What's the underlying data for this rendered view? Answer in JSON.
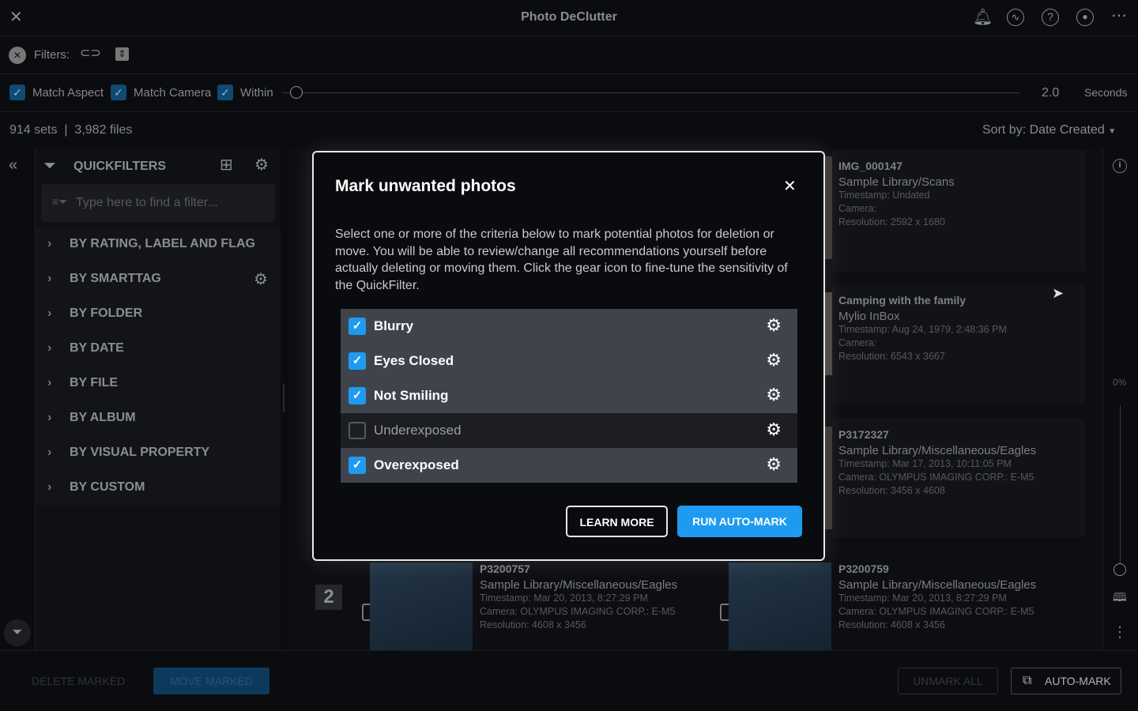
{
  "app": {
    "title": "Photo DeClutter"
  },
  "filters": {
    "label": "Filters:",
    "match_aspect": "Match Aspect",
    "match_camera": "Match Camera",
    "within": "Within",
    "within_value": "2.0",
    "within_unit": "Seconds",
    "slider_fraction": 0.02
  },
  "stats": {
    "sets": "914 sets",
    "separator": "|",
    "files": "3,982 files",
    "sort_label": "Sort by:",
    "sort_value": "Date Created"
  },
  "quickfilters": {
    "title": "QUICKFILTERS",
    "search_placeholder": "Type here to find a filter...",
    "items": [
      "BY RATING, LABEL AND FLAG",
      "BY SMARTTAG",
      "BY FOLDER",
      "BY DATE",
      "BY FILE",
      "BY ALBUM",
      "BY VISUAL PROPERTY",
      "BY CUSTOM"
    ]
  },
  "cards": [
    {
      "name": "IMG_000147",
      "path": "Sample Library/Scans",
      "timestamp": "Timestamp: Undated",
      "camera": "Camera:",
      "resolution": "Resolution: 2592 x 1680"
    },
    {
      "name": "Camping with the family",
      "path": "Mylio InBox",
      "timestamp": "Timestamp: Aug 24, 1979, 2:48:36 PM",
      "camera": "Camera:",
      "resolution": "Resolution: 6543 x 3667"
    },
    {
      "name": "P3172327",
      "path": "Sample Library/Miscellaneous/Eagles",
      "timestamp": "Timestamp: Mar 17, 2013, 10:11:05 PM",
      "camera": "Camera: OLYMPUS IMAGING CORP.: E-M5",
      "resolution": "Resolution: 3456 x 4608"
    },
    {
      "name": "P3200757",
      "path": "Sample Library/Miscellaneous/Eagles",
      "timestamp": "Timestamp: Mar 20, 2013, 8:27:29 PM",
      "camera": "Camera: OLYMPUS IMAGING CORP.: E-M5",
      "resolution": "Resolution: 4608 x 3456"
    },
    {
      "name": "P3200759",
      "path": "Sample Library/Miscellaneous/Eagles",
      "timestamp": "Timestamp: Mar 20, 2013, 8:27:29 PM",
      "camera": "Camera: OLYMPUS IMAGING CORP.: E-M5",
      "resolution": "Resolution: 4608 x 3456"
    }
  ],
  "set_number": "2",
  "rail": {
    "zoom_percent": "0%"
  },
  "bottom": {
    "delete_marked": "DELETE MARKED",
    "move_marked": "MOVE MARKED",
    "unmark_all": "UNMARK ALL",
    "auto_mark": "AUTO-MARK"
  },
  "modal": {
    "title": "Mark unwanted photos",
    "description": "Select one or more of the criteria below to mark potential photos for deletion or move. You will be able to review/change all recommendations yourself before actually deleting or moving them. Click the gear icon to fine-tune the sensitivity of the QuickFilter.",
    "criteria": [
      {
        "label": "Blurry",
        "checked": true
      },
      {
        "label": "Eyes Closed",
        "checked": true
      },
      {
        "label": "Not Smiling",
        "checked": true
      },
      {
        "label": "Underexposed",
        "checked": false
      },
      {
        "label": "Overexposed",
        "checked": true
      }
    ],
    "learn_more": "LEARN MORE",
    "run": "RUN AUTO-MARK"
  },
  "colors": {
    "accent": "#1e9bf0",
    "row": "#3f444c"
  }
}
